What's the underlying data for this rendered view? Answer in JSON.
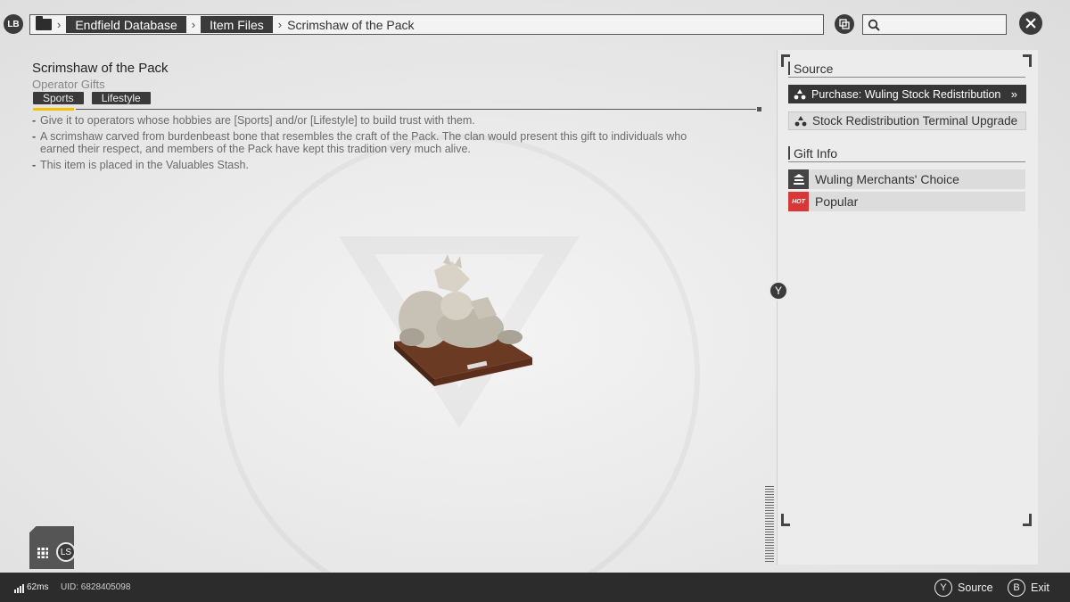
{
  "topbar": {
    "lb_label": "LB",
    "breadcrumb": {
      "folder_icon": "folder-icon",
      "crumbs": [
        "Endfield Database",
        "Item Files"
      ],
      "current": "Scrimshaw of the Pack"
    },
    "switch_icon": "switch-view-icon",
    "search_icon": "search-icon",
    "search_placeholder": "",
    "close_icon": "close-x-icon"
  },
  "item": {
    "title": "Scrimshaw of the Pack",
    "category": "Operator Gifts",
    "tags": [
      "Sports",
      "Lifestyle"
    ],
    "description": [
      "Give it to operators whose hobbies are [Sports] and/or [Lifestyle] to build trust with them.",
      "A scrimshaw carved from burdenbeast bone that resembles the craft of the Pack. The clan would present this gift to individuals who earned their respect, and members of the Pack have kept this tradition very much alive.",
      "This item is placed in the Valuables Stash."
    ],
    "image_icon": "wolf-scrimshaw-image"
  },
  "panel": {
    "source_heading": "Source",
    "sources": [
      {
        "label": "Purchase: Wuling Stock Redistribution",
        "icon": "source-icon",
        "selected": true
      },
      {
        "label": "Stock Redistribution Terminal Upgrade",
        "icon": "source-icon",
        "selected": false
      }
    ],
    "gift_heading": "Gift Info",
    "gift_info": [
      {
        "label": "Wuling Merchants' Choice",
        "icon": "merchant-icon"
      },
      {
        "label": "Popular",
        "icon": "hot-icon",
        "icon_text": "HOT"
      }
    ],
    "y_label": "Y"
  },
  "corner": {
    "ls_label": "LS"
  },
  "bottombar": {
    "ping": "62ms",
    "uid": "UID: 6828405098",
    "actions": [
      {
        "key": "Y",
        "label": "Source"
      },
      {
        "key": "B",
        "label": "Exit"
      }
    ]
  },
  "colors": {
    "accent": "#f2c200",
    "dark": "#363636",
    "hot": "#d93838"
  }
}
